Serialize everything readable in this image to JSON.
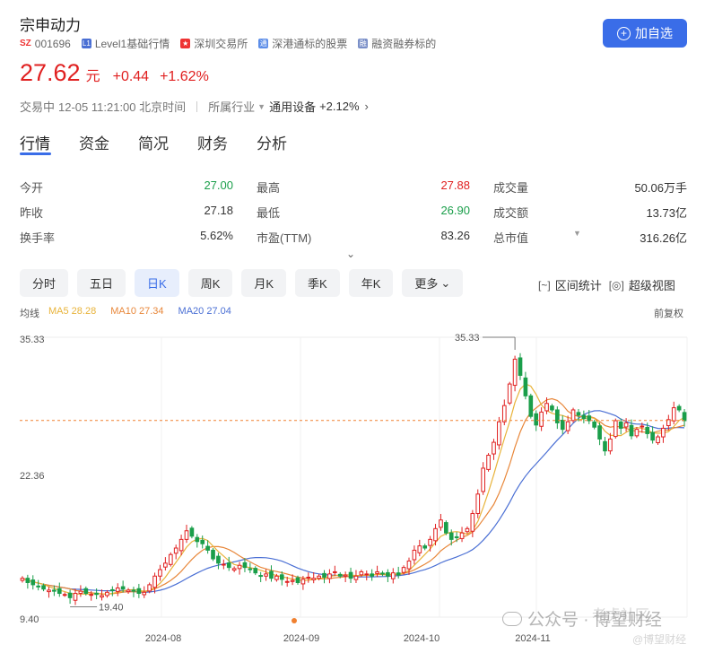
{
  "header": {
    "stock_name": "宗申动力",
    "market": "SZ",
    "code": "001696",
    "badges": [
      "Level1基础行情",
      "深圳交易所",
      "深港通标的股票",
      "融资融券标的"
    ],
    "add_watchlist": "加自选"
  },
  "price": {
    "last": "27.62",
    "unit": "元",
    "change": "+0.44",
    "change_pct": "+1.62%"
  },
  "status": {
    "state": "交易中",
    "time": "12-05 11:21:00 北京时间",
    "industry_label": "所属行业",
    "industry_name": "通用设备",
    "industry_change": "+2.12%"
  },
  "tabs": [
    "行情",
    "资金",
    "简况",
    "财务",
    "分析"
  ],
  "quote": [
    [
      {
        "label": "今开",
        "value": "27.00",
        "dir": "down"
      },
      {
        "label": "最高",
        "value": "27.88",
        "dir": "up"
      },
      {
        "label": "成交量",
        "value": "50.06万手",
        "dir": ""
      }
    ],
    [
      {
        "label": "昨收",
        "value": "27.18",
        "dir": ""
      },
      {
        "label": "最低",
        "value": "26.90",
        "dir": "down"
      },
      {
        "label": "成交额",
        "value": "13.73亿",
        "dir": ""
      }
    ],
    [
      {
        "label": "换手率",
        "value": "5.62%",
        "dir": ""
      },
      {
        "label": "市盈(TTM)",
        "value": "83.26",
        "dir": ""
      },
      {
        "label": "总市值",
        "value": "316.26亿",
        "dir": ""
      }
    ]
  ],
  "periods": [
    "分时",
    "五日",
    "日K",
    "周K",
    "月K",
    "季K",
    "年K",
    "更多"
  ],
  "active_period": "日K",
  "tools": [
    "区间统计",
    "超级视图"
  ],
  "ma": {
    "label": "均线",
    "ma5": "MA5 28.28",
    "ma10": "MA10 27.34",
    "ma20": "MA20 27.04",
    "adjust": "前复权"
  },
  "colors": {
    "up": "#e02020",
    "down": "#1a9e4a",
    "accent": "#3a6de8",
    "ma5": "#e8b33a",
    "ma10": "#e8873a",
    "ma20": "#4a6fd4"
  },
  "chart_data": {
    "type": "candlestick",
    "y_labels": [
      "35.33",
      "22.36",
      "9.40"
    ],
    "max_label": "35.33",
    "min_label": "19.40",
    "x_labels": [
      "2024-08",
      "2024-09",
      "2024-10",
      "2024-11"
    ],
    "ylim": [
      9.4,
      35.33
    ],
    "current_price": 27.62,
    "closes": [
      13.0,
      12.6,
      12.4,
      12.2,
      12.0,
      11.9,
      11.8,
      11.6,
      11.5,
      11.2,
      11.6,
      11.8,
      11.6,
      11.5,
      11.5,
      11.4,
      11.7,
      11.9,
      12.1,
      12.0,
      11.9,
      11.8,
      11.6,
      11.7,
      12.4,
      13.2,
      13.8,
      14.4,
      15.2,
      15.8,
      16.6,
      17.4,
      16.9,
      16.4,
      16.2,
      15.6,
      14.8,
      14.4,
      14.3,
      14.0,
      13.9,
      14.2,
      14.0,
      13.8,
      13.5,
      13.2,
      13.4,
      13.0,
      13.2,
      12.9,
      12.7,
      12.8,
      12.6,
      12.9,
      13.1,
      13.0,
      13.2,
      13.1,
      13.4,
      13.6,
      13.2,
      13.3,
      13.0,
      13.2,
      13.6,
      13.4,
      13.2,
      13.6,
      13.4,
      13.2,
      13.5,
      13.3,
      14.0,
      14.6,
      15.6,
      16.0,
      15.8,
      16.6,
      17.6,
      18.4,
      17.2,
      16.6,
      16.8,
      17.2,
      17.6,
      19.0,
      20.8,
      23.2,
      24.4,
      25.6,
      27.5,
      29.0,
      31.0,
      33.3,
      31.8,
      29.9,
      28.0,
      27.2,
      28.4,
      29.2,
      28.6,
      27.4,
      26.8,
      27.5,
      28.6,
      28.1,
      27.8,
      27.6,
      27.0,
      25.9,
      24.8,
      25.9,
      27.6,
      26.9,
      27.4,
      26.2,
      26.8,
      27.1,
      26.4,
      25.8,
      26.1,
      26.9,
      27.7,
      28.8,
      28.6,
      27.6
    ]
  }
}
